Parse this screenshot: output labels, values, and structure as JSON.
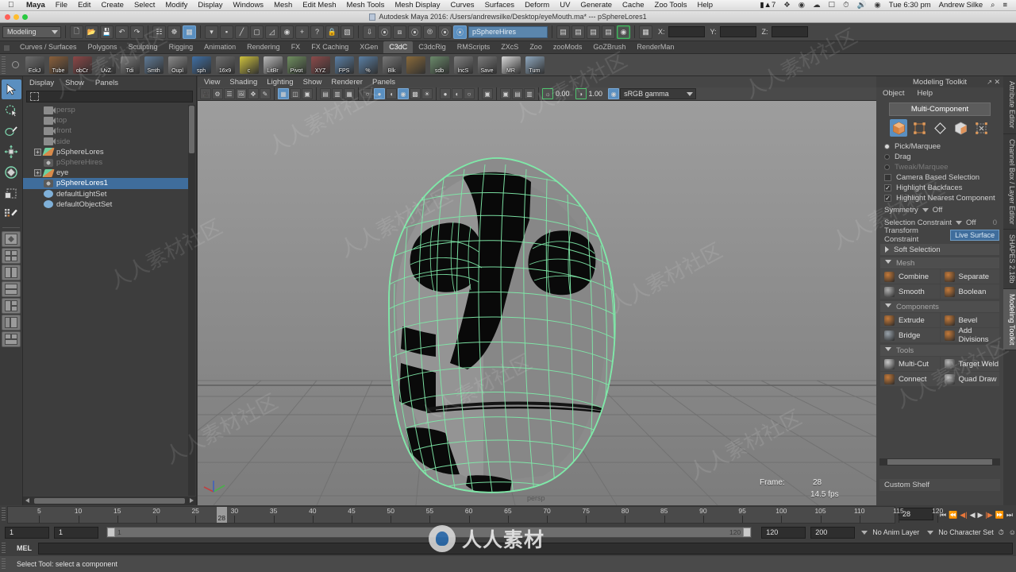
{
  "macmenu": {
    "apple_icon": "apple-icon",
    "items": [
      "Maya",
      "File",
      "Edit",
      "Create",
      "Select",
      "Modify",
      "Display",
      "Windows",
      "Mesh",
      "Edit Mesh",
      "Mesh Tools",
      "Mesh Display",
      "Curves",
      "Surfaces",
      "Deform",
      "UV",
      "Generate",
      "Cache",
      "Zoo Tools",
      "Help"
    ],
    "status_icons": [
      "volume-meter-icon",
      "dropbox-icon",
      "at-icon",
      "cloud-icon",
      "display-icon",
      "clock-icon",
      "sound-icon",
      "wifi-icon"
    ],
    "badge_number": "7",
    "time": "Tue 6:30 pm",
    "user": "Andrew Silke",
    "search_icon": "search-icon",
    "list_icon": "notification-center-icon"
  },
  "titlebar": {
    "title": "Autodesk Maya 2016: /Users/andrewsilke/Desktop/eyeMouth.ma*  ---  pSphereLores1"
  },
  "statusline": {
    "menuset": "Modeling",
    "selection_field": "pSphereHires",
    "coord_x_label": "X:",
    "coord_y_label": "Y:",
    "coord_z_label": "Z:",
    "coord_x": "",
    "coord_y": "",
    "coord_z": ""
  },
  "shelf": {
    "tabs": [
      "Curves / Surfaces",
      "Polygons",
      "Sculpting",
      "Rigging",
      "Animation",
      "Rendering",
      "FX",
      "FX Caching",
      "XGen",
      "C3dC",
      "C3dcRig",
      "RMScripts",
      "ZXcS",
      "Zoo",
      "zooMods",
      "GoZBrush",
      "RenderMan"
    ],
    "active_tab": "C3dC",
    "buttons": [
      {
        "label": "EckJ",
        "color": "#6d6d6d"
      },
      {
        "label": "Tube",
        "color": "#8a5f3a"
      },
      {
        "label": "obCr",
        "color": "#8c4646"
      },
      {
        "label": "UvZ",
        "color": "#5a5a5a"
      },
      {
        "label": "Tdi",
        "color": "#7d7d7d"
      },
      {
        "label": "Smth",
        "color": "#5f7a96"
      },
      {
        "label": "Oupl",
        "color": "#8a8a8a"
      },
      {
        "label": "sph",
        "color": "#3f6fa5"
      },
      {
        "label": "16x9",
        "color": "#6d6d6d"
      },
      {
        "label": "c",
        "color": "#cfc23d"
      },
      {
        "label": "LitBr",
        "color": "#b9b9b9"
      },
      {
        "label": "Pivot",
        "color": "#6f8f5f"
      },
      {
        "label": "XYZ",
        "color": "#8c4a4a"
      },
      {
        "label": "FPS",
        "color": "#5a7fa5"
      },
      {
        "label": "%",
        "color": "#5a7fa5"
      },
      {
        "label": "Blk",
        "color": "#777777"
      },
      {
        "label": "",
        "color": "#8a6a3a"
      },
      {
        "label": "sdb",
        "color": "#6a8a6a"
      },
      {
        "label": "lncS",
        "color": "#808080"
      },
      {
        "label": "Save",
        "color": "#7a7a7a"
      },
      {
        "label": "MR",
        "color": "#d8d8d8"
      },
      {
        "label": "Turn",
        "color": "#8fa8bf"
      }
    ]
  },
  "toolbox": {
    "items": [
      "select-tool",
      "lasso-tool",
      "paint-select-tool",
      "move-tool",
      "rotate-tool",
      "scale-tool",
      "last-tool",
      "show-manipulator-tool"
    ],
    "layouts": [
      "single-perspective-layout",
      "four-view-layout",
      "two-pane-side-layout",
      "two-pane-stacked-layout",
      "three-pane-layout",
      "outliner-persp-layout",
      "hypergraph-layout"
    ]
  },
  "outliner": {
    "menus": [
      "Display",
      "Show",
      "Panels"
    ],
    "search_value": "",
    "rows": [
      {
        "label": "persp",
        "icon": "camera-icon",
        "dim": true,
        "expandable": false,
        "selected": false
      },
      {
        "label": "top",
        "icon": "camera-icon",
        "dim": true,
        "expandable": false,
        "selected": false
      },
      {
        "label": "front",
        "icon": "camera-icon",
        "dim": true,
        "expandable": false,
        "selected": false
      },
      {
        "label": "side",
        "icon": "camera-icon",
        "dim": true,
        "expandable": false,
        "selected": false
      },
      {
        "label": "pSphereLores",
        "icon": "mesh-icon",
        "dim": false,
        "expandable": true,
        "selected": false
      },
      {
        "label": "pSphereHires",
        "icon": "shape-icon",
        "dim": true,
        "expandable": false,
        "selected": false
      },
      {
        "label": "eye",
        "icon": "mesh-icon",
        "dim": false,
        "expandable": true,
        "selected": false
      },
      {
        "label": "pSphereLores1",
        "icon": "shape-icon",
        "dim": false,
        "expandable": false,
        "selected": true
      },
      {
        "label": "defaultLightSet",
        "icon": "set-icon",
        "dim": false,
        "expandable": false,
        "selected": false
      },
      {
        "label": "defaultObjectSet",
        "icon": "set-icon",
        "dim": false,
        "expandable": false,
        "selected": false
      }
    ]
  },
  "viewport": {
    "menus": [
      "View",
      "Shading",
      "Lighting",
      "Show",
      "Renderer",
      "Panels"
    ],
    "exposure_value": "0.00",
    "gamma_value": "1.00",
    "color_profile": "sRGB gamma",
    "camera_label": "persp",
    "hud_frame_label": "Frame:",
    "hud_frame_value": "28",
    "hud_fps": "14.5 fps"
  },
  "modeling_toolkit": {
    "panel_title": "Modeling Toolkit",
    "menus": [
      "Object",
      "Help"
    ],
    "multi_component_label": "Multi-Component",
    "mode_icons": [
      "object-mode-icon",
      "vertex-mode-icon",
      "edge-mode-icon",
      "face-mode-icon",
      "uv-mode-icon"
    ],
    "options": [
      {
        "label": "Pick/Marquee",
        "type": "radio",
        "checked": true,
        "dim": false
      },
      {
        "label": "Drag",
        "type": "radio",
        "checked": false,
        "dim": false
      },
      {
        "label": "Tweak/Marquee",
        "type": "radio",
        "checked": false,
        "dim": true
      },
      {
        "label": "Camera Based Selection",
        "type": "checkbox",
        "checked": false,
        "dim": false
      },
      {
        "label": "Highlight Backfaces",
        "type": "checkbox",
        "checked": true,
        "dim": false
      },
      {
        "label": "Highlight Nearest Component",
        "type": "checkbox",
        "checked": true,
        "dim": false
      }
    ],
    "symmetry_label": "Symmetry",
    "symmetry_value": "Off",
    "selection_constraint_label": "Selection Constraint",
    "selection_constraint_value": "Off",
    "selection_constraint_num": "0",
    "transform_constraint_label": "Transform Constraint",
    "transform_constraint_value": "Live Surface",
    "soft_selection_label": "Soft Selection",
    "sections": [
      {
        "title": "Mesh",
        "buttons": [
          {
            "label": "Combine",
            "color": "#c47a3a"
          },
          {
            "label": "Separate",
            "color": "#c47a3a"
          },
          {
            "label": "Smooth",
            "color": "#b0b0b0"
          },
          {
            "label": "Boolean",
            "color": "#c47a3a"
          }
        ]
      },
      {
        "title": "Components",
        "buttons": [
          {
            "label": "Extrude",
            "color": "#c47a3a"
          },
          {
            "label": "Bevel",
            "color": "#c47a3a"
          },
          {
            "label": "Bridge",
            "color": "#9aa3ab"
          },
          {
            "label": "Add Divisions",
            "color": "#c47a3a"
          }
        ]
      },
      {
        "title": "Tools",
        "buttons": [
          {
            "label": "Multi-Cut",
            "color": "#c9c9c9"
          },
          {
            "label": "Target Weld",
            "color": "#b8b8b8"
          },
          {
            "label": "Connect",
            "color": "#c47a3a"
          },
          {
            "label": "Quad Draw",
            "color": "#bcbcbc"
          }
        ]
      }
    ],
    "custom_shelf_label": "Custom Shelf"
  },
  "vertical_tabs": {
    "items": [
      "Attribute Editor",
      "Channel Box / Layer Editor",
      "SHAPES 2.18b",
      "Modeling Toolkit"
    ],
    "active": "Modeling Toolkit"
  },
  "timeline": {
    "start": 1,
    "end": 120,
    "current_frame": "28",
    "tick_labels": [
      5,
      10,
      15,
      20,
      25,
      30,
      35,
      40,
      45,
      50,
      55,
      60,
      65,
      70,
      75,
      80,
      85,
      90,
      95,
      100,
      105,
      110,
      115,
      120
    ],
    "playback_icons": [
      "go-to-start",
      "step-back-key",
      "step-back-frame",
      "play-backwards",
      "play-forwards",
      "step-forward-frame",
      "step-forward-key",
      "go-to-end"
    ]
  },
  "rangeslider": {
    "anim_start": "1",
    "playback_start": "1",
    "range_left_label": "1",
    "range_right_label": "120",
    "playback_end": "120",
    "anim_end": "200",
    "anim_layer": "No Anim Layer",
    "character_set": "No Character Set"
  },
  "commandline": {
    "language_label": "MEL",
    "command_value": ""
  },
  "helpline": {
    "message": "Select Tool: select a component"
  },
  "colors": {
    "accent_blue": "#5a8fc0",
    "selection_blue": "#3f6d9c",
    "wireframe_green": "#7fe8a8",
    "orange_icon": "#c47a3a",
    "panel_bg": "#444444",
    "viewport_bg": "#8a8a8a"
  },
  "watermark": {
    "text": "人人素材",
    "tiles": [
      "人人素材社区",
      "人人素材社区",
      "人人素材社区",
      "人人素材社区",
      "人人素材社区",
      "人人素材社区",
      "人人素材社区",
      "人人素材社区",
      "人人素材社区",
      "人人素材社区",
      "人人素材社区",
      "人人素材社区"
    ]
  }
}
